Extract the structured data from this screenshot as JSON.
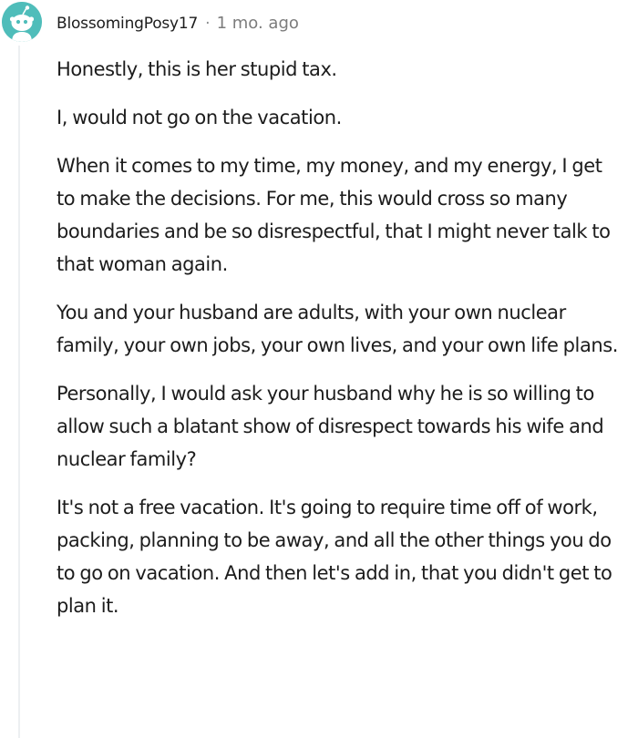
{
  "comment": {
    "author": "BlossomingPosy17",
    "separator": "·",
    "time": "1 mo. ago",
    "paragraphs": [
      "Honestly, this is her stupid tax.",
      "I, would not go on the vacation.",
      "When it comes to my time, my money, and my energy, I get to make the decisions. For me, this would cross so many boundaries and be so disrespectful, that I might never talk to that woman again.",
      "You and your husband are adults, with your own nuclear family, your own jobs, your own lives, and your own life plans.",
      "Personally, I would ask your husband why he is so willing to allow such a blatant show of disrespect towards his wife and nuclear family?",
      "It's not a free vacation. It's going to require time off of work, packing, planning to be away, and all the other things you do to go on vacation. And then let's add in, that you didn't get to plan it."
    ]
  },
  "colors": {
    "avatar_bg": "#4fbdba",
    "text": "#1c1c1c",
    "meta": "#7c7c7c",
    "thread_line": "#edeff1"
  },
  "icons": {
    "avatar": "reddit-snoo-avatar-icon"
  }
}
